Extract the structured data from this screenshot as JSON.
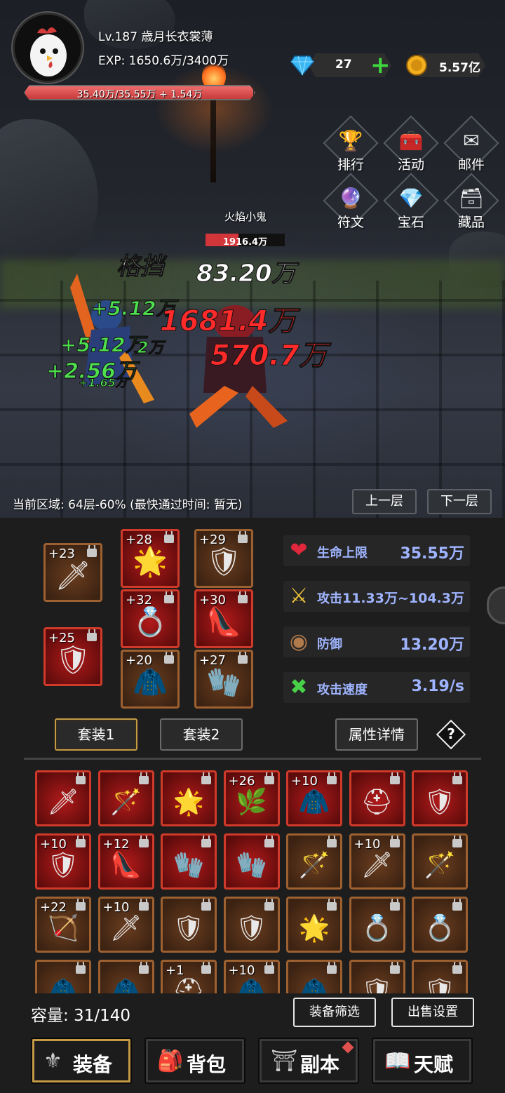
{
  "player": {
    "name": "Lv.187 歳月长衣裳薄",
    "exp": "EXP: 1650.6万/3400万",
    "hp_text": "35.40万/35.55万 + 1.54万",
    "hp_fraction": 0.996
  },
  "currency": {
    "gems": "27",
    "gold": "5.57亿",
    "gem_icon": "diamond-icon",
    "gold_icon": "gold-coin-icon"
  },
  "menu": [
    {
      "label": "排行",
      "icon": "trophy-icon"
    },
    {
      "label": "活动",
      "icon": "treasure-chest-icon"
    },
    {
      "label": "邮件",
      "icon": "envelope-icon"
    },
    {
      "label": "符文",
      "icon": "rune-icon"
    },
    {
      "label": "宝石",
      "icon": "gem-icon"
    },
    {
      "label": "藏品",
      "icon": "collection-chest-icon"
    }
  ],
  "enemy": {
    "name": "火焰小鬼",
    "hp_text": "1916.4万",
    "hp_fraction": 0.42
  },
  "damage": {
    "block": "格挡",
    "white": "83.20万",
    "red1": "1681.4万",
    "red2": "570.7万",
    "heal1": "+5.12万",
    "heal2": "+5.12万",
    "heal3": "+2.56万",
    "heal_small": "+1.65万",
    "partial": "2万"
  },
  "zone": {
    "text": "当前区域: 64层-60% (最快通过时间: 暂无)",
    "prev": "上一层",
    "next": "下一层"
  },
  "equipped": [
    {
      "level": "+23",
      "icon": "sword-icon",
      "glyph": "🗡",
      "style": "brown"
    },
    {
      "level": "+28",
      "icon": "star-amulet-icon",
      "glyph": "🌟",
      "style": "red"
    },
    {
      "level": "+29",
      "icon": "gold-armor-icon",
      "glyph": "🛡",
      "style": "brown"
    },
    {
      "level": "+32",
      "icon": "silver-ring-icon",
      "glyph": "💍",
      "style": "red"
    },
    {
      "level": "+30",
      "icon": "pink-heel-icon",
      "glyph": "👠",
      "style": "red"
    },
    {
      "level": "+25",
      "icon": "crest-shield-icon",
      "glyph": "🛡",
      "style": "red"
    },
    {
      "level": "+20",
      "icon": "white-hood-icon",
      "glyph": "🧥",
      "style": "brown"
    },
    {
      "level": "+27",
      "icon": "black-glove-icon",
      "glyph": "🧤",
      "style": "brown"
    }
  ],
  "stats": [
    {
      "label": "生命上限",
      "value": "35.55万",
      "icon": "heart-icon",
      "glyph": "❤",
      "color": "#e0273b"
    },
    {
      "label": "攻击",
      "value": "11.33万~104.3万",
      "icon": "sword-attack-icon",
      "glyph": "⚔",
      "color": "#f2c53d"
    },
    {
      "label": "防御",
      "value": "13.20万",
      "icon": "round-shield-icon",
      "glyph": "◉",
      "color": "#b07a4a"
    },
    {
      "label": "攻击速度",
      "value": "3.19/s",
      "icon": "crossed-arrows-icon",
      "glyph": "✖",
      "color": "#48d048"
    }
  ],
  "sets": {
    "set1": "套装1",
    "set2": "套装2",
    "details": "属性详情",
    "help": "?"
  },
  "inventory": [
    {
      "level": "",
      "icon": "sword-icon",
      "glyph": "🗡",
      "style": "red"
    },
    {
      "level": "",
      "icon": "staff-icon",
      "glyph": "🪄",
      "style": "red"
    },
    {
      "level": "",
      "icon": "star-amulet-icon",
      "glyph": "🌟",
      "style": "red"
    },
    {
      "level": "+26",
      "icon": "green-wreath-icon",
      "glyph": "🌿",
      "style": "red"
    },
    {
      "level": "+10",
      "icon": "white-hood-icon",
      "glyph": "🧥",
      "style": "red"
    },
    {
      "level": "",
      "icon": "knight-helmet-icon",
      "glyph": "⛑",
      "style": "red"
    },
    {
      "level": "",
      "icon": "gold-armor-icon",
      "glyph": "🛡",
      "style": "red"
    },
    {
      "level": "+10",
      "icon": "gold-armor-icon",
      "glyph": "🛡",
      "style": "red"
    },
    {
      "level": "+12",
      "icon": "pink-heel-icon",
      "glyph": "👠",
      "style": "red"
    },
    {
      "level": "",
      "icon": "black-glove-icon",
      "glyph": "🧤",
      "style": "red"
    },
    {
      "level": "",
      "icon": "black-glove-icon",
      "glyph": "🧤",
      "style": "red"
    },
    {
      "level": "",
      "icon": "staff-icon",
      "glyph": "🪄",
      "style": "brown"
    },
    {
      "level": "+10",
      "icon": "sword-icon",
      "glyph": "🗡",
      "style": "brown"
    },
    {
      "level": "",
      "icon": "staff-icon",
      "glyph": "🪄",
      "style": "brown"
    },
    {
      "level": "+22",
      "icon": "bow-icon",
      "glyph": "🏹",
      "style": "brown"
    },
    {
      "level": "+10",
      "icon": "sword-icon",
      "glyph": "🗡",
      "style": "brown"
    },
    {
      "level": "",
      "icon": "round-shield-icon",
      "glyph": "🛡",
      "style": "brown"
    },
    {
      "level": "",
      "icon": "crest-shield-icon",
      "glyph": "🛡",
      "style": "brown"
    },
    {
      "level": "",
      "icon": "star-amulet-icon",
      "glyph": "🌟",
      "style": "brown"
    },
    {
      "level": "",
      "icon": "gem-ring-icon",
      "glyph": "💍",
      "style": "brown"
    },
    {
      "level": "",
      "icon": "silver-ring-icon",
      "glyph": "💍",
      "style": "brown"
    },
    {
      "level": "",
      "icon": "white-hood-icon",
      "glyph": "🧥",
      "style": "brown"
    },
    {
      "level": "",
      "icon": "white-hood-icon",
      "glyph": "🧥",
      "style": "brown"
    },
    {
      "level": "+1",
      "icon": "knight-helmet-icon",
      "glyph": "⛑",
      "style": "brown"
    },
    {
      "level": "+10",
      "icon": "white-hood-icon",
      "glyph": "🧥",
      "style": "brown"
    },
    {
      "level": "",
      "icon": "white-hood-icon",
      "glyph": "🧥",
      "style": "brown"
    },
    {
      "level": "",
      "icon": "gold-armor-icon",
      "glyph": "🛡",
      "style": "brown"
    },
    {
      "level": "",
      "icon": "plate-armor-icon",
      "glyph": "🛡",
      "style": "brown"
    }
  ],
  "capacity": "容量: 31/140",
  "filter_btn": "装备筛选",
  "sell_btn": "出售设置",
  "tabs": [
    {
      "label": "装备",
      "icon": "trident-icon",
      "glyph": "⚜"
    },
    {
      "label": "背包",
      "icon": "backpack-icon",
      "glyph": "🎒"
    },
    {
      "label": "副本",
      "icon": "dungeon-gate-icon",
      "glyph": "⛩"
    },
    {
      "label": "天赋",
      "icon": "talent-book-icon",
      "glyph": "📖"
    }
  ]
}
